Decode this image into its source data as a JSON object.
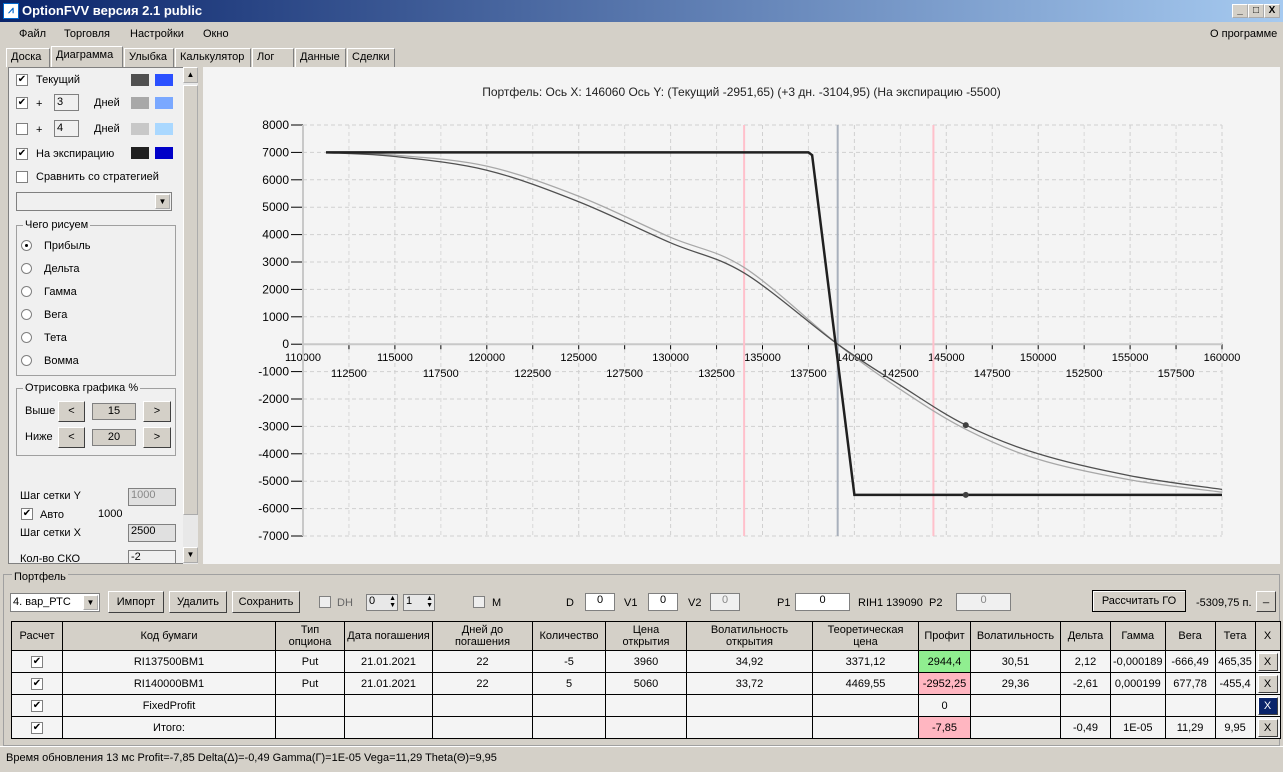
{
  "window": {
    "title": "OptionFVV версия 2.1 public",
    "logo": "FVV",
    "min": "_",
    "max": "□",
    "close": "X"
  },
  "menu": {
    "items": [
      "Файл",
      "Торговля",
      "Настройки",
      "Окно"
    ],
    "about": "О программе"
  },
  "tabs": [
    "Доска",
    "Диаграмма",
    "Улыбка",
    "Калькулятор",
    "Лог",
    "Данные",
    "Сделки"
  ],
  "active_tab": "Диаграмма",
  "left": {
    "current": {
      "label": "Текущий",
      "checked": true,
      "colors": [
        "#505050",
        "#2b50ff"
      ]
    },
    "plus1": {
      "plus": "+",
      "days": "3",
      "label": "Дней",
      "checked": true,
      "colors": [
        "#a8a8a8",
        "#7aa8ff"
      ]
    },
    "plus2": {
      "plus": "+",
      "days": "4",
      "label": "Дней",
      "checked": false,
      "colors": [
        "#c8c8c8",
        "#aad8ff"
      ]
    },
    "expiration": {
      "label": "На экспирацию",
      "checked": true,
      "colors": [
        "#202020",
        "#0000c8"
      ]
    },
    "compare": {
      "label": "Сравнить со стратегией",
      "checked": false
    },
    "draw_group": {
      "title": "Чего рисуем",
      "options": [
        "Прибыль",
        "Дельта",
        "Гамма",
        "Вега",
        "Тета",
        "Вомма"
      ],
      "selected": "Прибыль"
    },
    "range_group": {
      "title": "Отрисовка графика %",
      "above_label": "Выше",
      "above": "15",
      "below_label": "Ниже",
      "below": "20",
      "dec": "<",
      "inc": ">"
    },
    "grid_y_label": "Шаг сетки Y",
    "grid_y": "1000",
    "auto_label": "Авто",
    "auto_checked": true,
    "auto_value": "1000",
    "grid_x_label": "Шаг сетки X",
    "grid_x": "2500",
    "sko_label": "Кол-во СКО",
    "sko": "-2"
  },
  "chart_data": {
    "type": "line",
    "title": "Портфель: Ось X: 146060 Ось Y:  (Текущий -2951,65)  (+3 дн. -3104,95)  (На экспирацию -5500)",
    "xlim": [
      110000,
      160000
    ],
    "ylim": [
      -7000,
      8000
    ],
    "x_ticks_major": [
      110000,
      115000,
      120000,
      125000,
      130000,
      135000,
      140000,
      145000,
      150000,
      155000,
      160000
    ],
    "x_ticks_minor": [
      112500,
      117500,
      122500,
      127500,
      132500,
      137500,
      142500,
      147500,
      152500,
      157500
    ],
    "y_ticks": [
      8000,
      7000,
      6000,
      5000,
      4000,
      3000,
      2000,
      1000,
      0,
      -1000,
      -2000,
      -3000,
      -4000,
      -5000,
      -6000,
      -7000
    ],
    "grid": true,
    "vlines": [
      {
        "x": 134000,
        "color": "#ffc0cb"
      },
      {
        "x": 139090,
        "color": "#a8b0bc"
      },
      {
        "x": 144300,
        "color": "#ffc0cb"
      }
    ],
    "series": [
      {
        "key": "plus3",
        "color": "#a8a8a8",
        "points": [
          [
            111250,
            6995
          ],
          [
            115000,
            6900
          ],
          [
            120000,
            6500
          ],
          [
            125000,
            5400
          ],
          [
            130000,
            3900
          ],
          [
            134000,
            2800
          ],
          [
            139090,
            0
          ],
          [
            142500,
            -1650
          ],
          [
            146060,
            -3105
          ],
          [
            150000,
            -4200
          ],
          [
            155000,
            -4950
          ],
          [
            160000,
            -5400
          ]
        ]
      },
      {
        "key": "current",
        "color": "#505050",
        "points": [
          [
            111250,
            6990
          ],
          [
            115000,
            6850
          ],
          [
            120000,
            6350
          ],
          [
            125000,
            5200
          ],
          [
            130000,
            3700
          ],
          [
            134000,
            2600
          ],
          [
            139090,
            0
          ],
          [
            142500,
            -1500
          ],
          [
            146060,
            -2952
          ],
          [
            150000,
            -4000
          ],
          [
            155000,
            -4800
          ],
          [
            160000,
            -5300
          ]
        ]
      },
      {
        "key": "expiration",
        "color": "#202020",
        "points": [
          [
            111250,
            7000
          ],
          [
            137500,
            7000
          ],
          [
            137700,
            6900
          ],
          [
            140000,
            -5500
          ],
          [
            160000,
            -5500
          ]
        ]
      }
    ],
    "markers": [
      {
        "x": 146060,
        "y": -2952
      },
      {
        "x": 146060,
        "y": -5500
      }
    ]
  },
  "portfolio": {
    "title": "Портфель",
    "selected": "4. вар_РТС",
    "import": "Импорт",
    "delete": "Удалить",
    "save": "Сохранить",
    "dh_label": "DH",
    "dh_checked": false,
    "spin1": "0",
    "spin2": "1",
    "m_label": "M",
    "m_checked": false,
    "d_label": "D",
    "d": "0",
    "v1_label": "V1",
    "v1": "0",
    "v2_label": "V2",
    "v2": "0",
    "p1_label": "P1",
    "p1": "0",
    "instrument": "RIH1 139090",
    "p2_label": "P2",
    "p2": "0",
    "calc_go": "Рассчитать ГО",
    "go_value": "-5309,75 п.",
    "minimize": "_"
  },
  "table": {
    "headers": [
      "Расчет",
      "Код бумаги",
      "Тип опциона",
      "Дата погашения",
      "Дней до погашения",
      "Количество",
      "Цена открытия",
      "Волатильность открытия",
      "Теоретическая цена",
      "Профит",
      "Волатильность",
      "Дельта",
      "Гамма",
      "Вега",
      "Тета",
      "X"
    ],
    "rows": [
      {
        "checked": true,
        "cells": [
          "RI137500BM1",
          "Put",
          "21.01.2021",
          "22",
          "-5",
          "3960",
          "34,92",
          "3371,12",
          "2944,4",
          "30,51",
          "2,12",
          "-0,000189",
          "-666,49",
          "465,35"
        ],
        "profit_state": "pos"
      },
      {
        "checked": true,
        "cells": [
          "RI140000BM1",
          "Put",
          "21.01.2021",
          "22",
          "5",
          "5060",
          "33,72",
          "4469,55",
          "-2952,25",
          "29,36",
          "-2,61",
          "0,000199",
          "677,78",
          "-455,4"
        ],
        "profit_state": "neg"
      },
      {
        "checked": true,
        "cells": [
          "FixedProfit",
          "",
          "",
          "",
          "",
          "",
          "",
          "",
          "0",
          "",
          "",
          "",
          "",
          ""
        ],
        "profit_state": "",
        "selected_x": true
      },
      {
        "checked": true,
        "cells": [
          "Итого:",
          "",
          "",
          "",
          "",
          "",
          "",
          "",
          "-7,85",
          "",
          "-0,49",
          "1E-05",
          "11,29",
          "9,95"
        ],
        "profit_state": "neg"
      }
    ],
    "x_label": "X",
    "check": "✔"
  },
  "status": "Время обновления 13 мс  Profit=-7,85 Delta(Δ)=-0,49 Gamma(Γ)=1E-05 Vega=11,29 Theta(Θ)=9,95"
}
